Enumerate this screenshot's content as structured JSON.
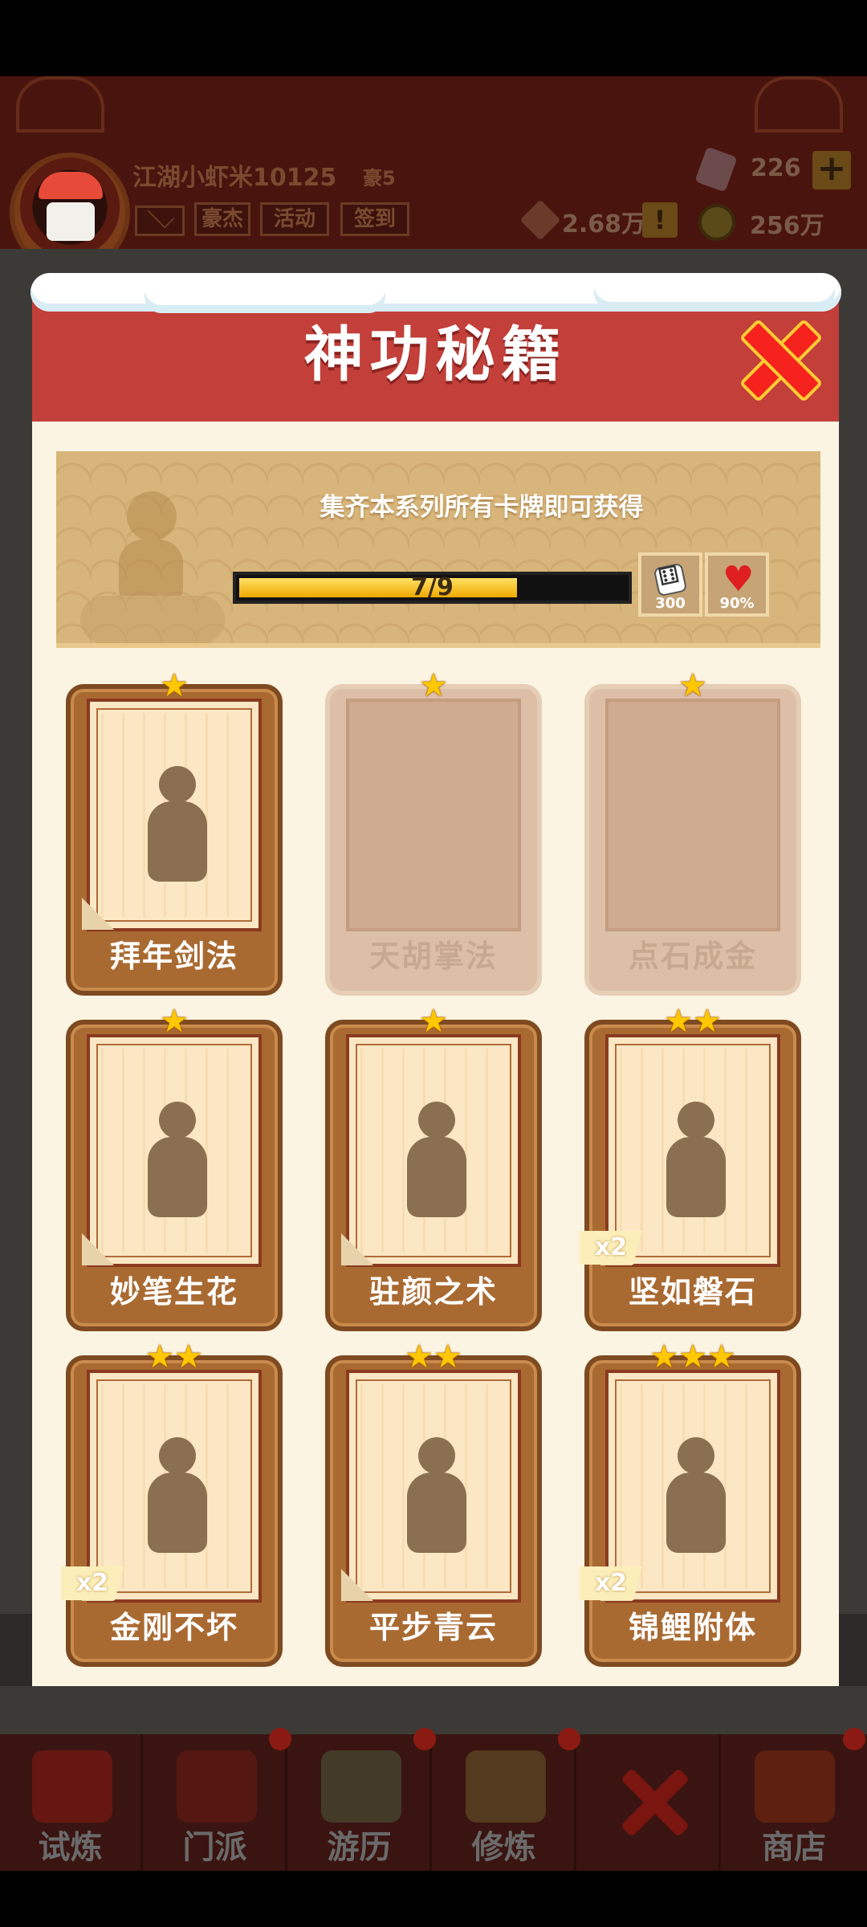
{
  "topbar": {
    "player_name": "江湖小虾米10125",
    "player_rank": "豪5",
    "buttons": [
      "豪杰",
      "活动",
      "签到"
    ],
    "gems": "226",
    "power": "2.68万",
    "coins": "256万",
    "plus": "+",
    "alert": "!"
  },
  "modal": {
    "title": "神功秘籍",
    "banner_text": "集齐本系列所有卡牌即可获得",
    "progress_label": "7/9",
    "progress_fraction": 0.72,
    "rewards": [
      {
        "icon": "dice-icon",
        "value": "300"
      },
      {
        "icon": "heart-icon",
        "value": "90%"
      }
    ],
    "cards": [
      {
        "name": "拜年剑法",
        "stars": "★",
        "locked": false,
        "multiplier": ""
      },
      {
        "name": "天胡掌法",
        "stars": "★",
        "locked": true,
        "multiplier": ""
      },
      {
        "name": "点石成金",
        "stars": "★",
        "locked": true,
        "multiplier": ""
      },
      {
        "name": "妙笔生花",
        "stars": "★",
        "locked": false,
        "multiplier": ""
      },
      {
        "name": "驻颜之术",
        "stars": "★",
        "locked": false,
        "multiplier": ""
      },
      {
        "name": "坚如磐石",
        "stars": "★★",
        "locked": false,
        "multiplier": "x2"
      },
      {
        "name": "金刚不坏",
        "stars": "★★",
        "locked": false,
        "multiplier": "x2"
      },
      {
        "name": "平步青云",
        "stars": "★★",
        "locked": false,
        "multiplier": ""
      },
      {
        "name": "锦鲤附体",
        "stars": "★★★",
        "locked": false,
        "multiplier": "x2"
      }
    ]
  },
  "bottom_nav": [
    {
      "label": "试炼"
    },
    {
      "label": "门派"
    },
    {
      "label": "游历"
    },
    {
      "label": "修炼"
    },
    {
      "label": ""
    },
    {
      "label": "商店"
    }
  ]
}
